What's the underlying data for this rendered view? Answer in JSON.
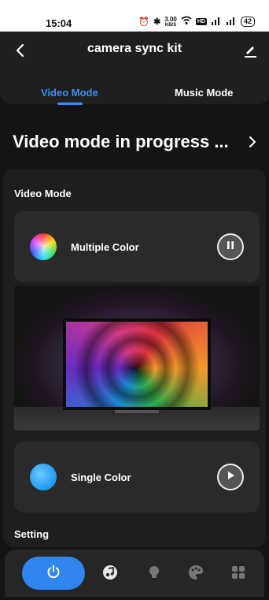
{
  "status_bar": {
    "time": "15:04",
    "speed_value": "3.00",
    "speed_unit": "KB/S",
    "hd_label": "HD",
    "battery": "42"
  },
  "header": {
    "title": "camera sync kit",
    "tabs": [
      {
        "label": "Video Mode",
        "active": true
      },
      {
        "label": "Music Mode",
        "active": false
      }
    ]
  },
  "progress": {
    "text": "Video mode in progress ..."
  },
  "video_mode": {
    "section_label": "Video Mode",
    "options": [
      {
        "label": "Multiple Color",
        "state": "playing",
        "control_icon": "pause-icon"
      },
      {
        "label": "Single Color",
        "state": "stopped",
        "control_icon": "play-icon"
      }
    ]
  },
  "setting": {
    "section_label": "Setting"
  },
  "bottom_nav": {
    "items": [
      "power-icon",
      "music-note-icon",
      "bulb-icon",
      "palette-icon",
      "grid-icon"
    ],
    "active": "power-icon"
  },
  "colors": {
    "accent": "#3a8ef6",
    "background": "#141414",
    "card": "#2a2a2a"
  }
}
